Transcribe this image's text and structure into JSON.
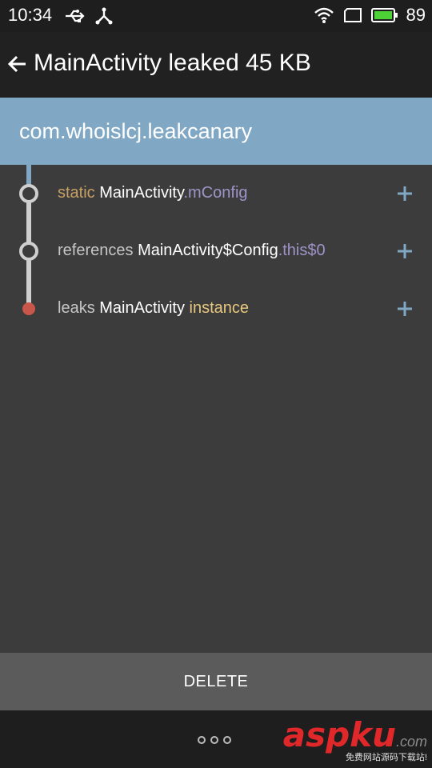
{
  "status_bar": {
    "time": "10:34",
    "battery": "89",
    "icons": [
      "usb-icon",
      "share-icon",
      "wifi-icon",
      "screen-rotate-icon",
      "battery-icon"
    ]
  },
  "app_bar": {
    "back_icon": "arrow-left-icon",
    "title": "MainActivity leaked 45 KB"
  },
  "package": {
    "name": "com.whoislcj.leakcanary",
    "color": "#80a8c4"
  },
  "trace": [
    {
      "kind": "static",
      "class": "MainActivity",
      "dot": ".",
      "field": "mConfig",
      "expand_icon": "plus-icon"
    },
    {
      "kind": "references",
      "class": "MainActivity$Config",
      "dot": ".",
      "field": "this$0",
      "expand_icon": "plus-icon"
    },
    {
      "kind": "leaks",
      "class": "MainActivity",
      "suffix": "instance",
      "expand_icon": "plus-icon"
    }
  ],
  "colors": {
    "leak_node": "#c8574a",
    "static_keyword": "#c8a064",
    "field": "#9f94c9",
    "instance": "#e8c77f"
  },
  "actions": {
    "delete_label": "DELETE"
  },
  "nav_bar": {
    "more_icon": "more-dots-icon"
  },
  "watermark": {
    "brand": "aspku",
    "domain": ".com",
    "tagline": "免费网站源码下载站!"
  }
}
